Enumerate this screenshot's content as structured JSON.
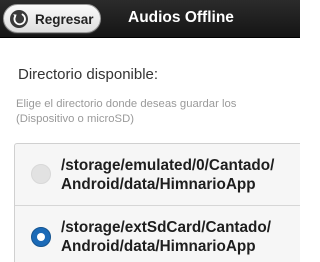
{
  "header": {
    "back_label": "Regresar",
    "title": "Audios Offline"
  },
  "section": {
    "heading": "Directorio disponible:",
    "description_line1": "Elige el directorio donde deseas guardar los",
    "description_line2": "(Dispositivo o microSD)"
  },
  "options": [
    {
      "line1": "/storage/emulated/0/Cantado/",
      "line2": "Android/data/HimnarioApp",
      "selected": false
    },
    {
      "line1": "/storage/extSdCard/Cantado/",
      "line2": "Android/data/HimnarioApp",
      "selected": true
    }
  ],
  "colors": {
    "header_bg": "#1e1e1e",
    "radio_selected": "#1b6ab7",
    "radio_unselected": "#e2e2e2"
  },
  "icons": {
    "back": "back-arrow-circle-icon"
  }
}
